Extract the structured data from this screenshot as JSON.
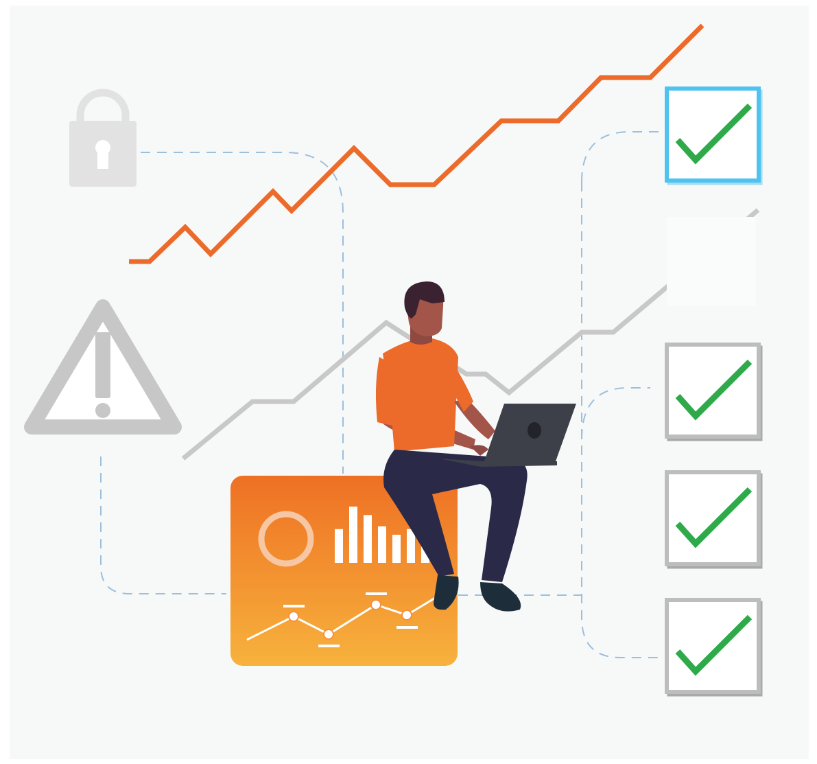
{
  "illustration": {
    "colors": {
      "background": "#f7f9f9",
      "accent_orange": "#ec6a2a",
      "trend_gray": "#c8c8c8",
      "connector_blue": "#9cbfdc",
      "lock_gray": "#e2e2e2",
      "warning_gray": "#c7c7c7",
      "check_green": "#2faa4a",
      "checkbox_border": "#bdbdbd",
      "checkbox_selected": "#4fc3ef",
      "card_top": "#ee7024",
      "card_bottom": "#f7b23c",
      "skin": "#a3554a",
      "hair": "#3a2230",
      "shirt": "#ec6a2a",
      "pants": "#2a2947",
      "laptop": "#3d4049"
    },
    "icons": [
      "lock-icon",
      "warning-icon",
      "checkbox-checked-icon",
      "dashboard-card",
      "person-with-laptop"
    ],
    "checklist": {
      "items": [
        {
          "checked": true,
          "selected": true
        },
        {
          "checked": false,
          "selected": false
        },
        {
          "checked": true,
          "selected": false
        },
        {
          "checked": true,
          "selected": false
        },
        {
          "checked": true,
          "selected": false
        }
      ]
    },
    "dashboard_card": {
      "bar_levels": [
        0.6,
        1.0,
        0.85,
        0.65,
        0.5,
        0.6,
        1.0
      ]
    }
  }
}
